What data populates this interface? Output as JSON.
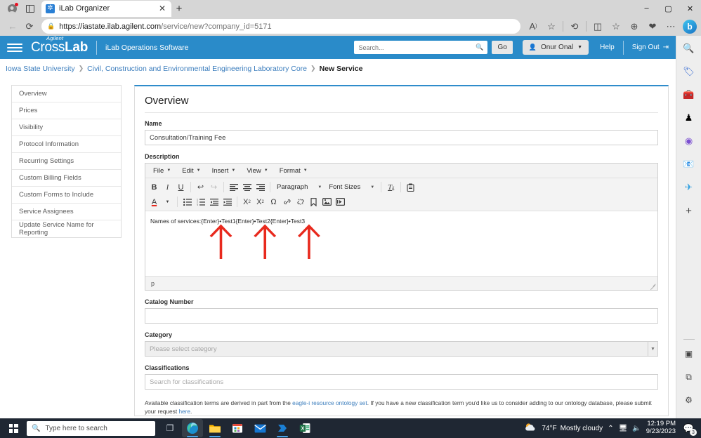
{
  "browser": {
    "tab": {
      "title": "iLab Organizer",
      "favicon": "ilab-favicon",
      "close": "✕"
    },
    "new_tab_label": "+",
    "window_controls": {
      "minimize": "–",
      "maximize": "▢",
      "close": "✕"
    },
    "nav": {
      "back": "←",
      "refresh": "⟳"
    },
    "url": {
      "lock": "🔒",
      "host": "https://iastate.ilab.agilent.com",
      "path": "/service/new?company_id=5171"
    },
    "toolbar_icons": [
      "read-aloud-icon",
      "favorite-star-icon",
      "history-icon",
      "split-screen-icon",
      "collections-icon",
      "browser-essentials-icon",
      "shopping-icon",
      "more-options-icon",
      "bing-copilot-icon"
    ]
  },
  "ilab": {
    "hamburger": "menu-icon",
    "brand": {
      "agilent": "Agilent",
      "cross": "Cross",
      "lab": "Lab"
    },
    "subtitle": "iLab Operations Software",
    "search": {
      "placeholder": "Search...",
      "value": "",
      "icon": "search-icon"
    },
    "go_label": "Go",
    "user": {
      "name": "Onur Onal",
      "icon": "user-icon",
      "caret": "▼"
    },
    "help_label": "Help",
    "signout_label": "Sign Out",
    "signout_icon": "signout-icon"
  },
  "breadcrumb": {
    "items": [
      "Iowa State University",
      "Civil, Construction and Environmental Engineering Laboratory Core"
    ],
    "current": "New Service",
    "separator": "❯"
  },
  "sidebar": {
    "items": [
      {
        "label": "Overview"
      },
      {
        "label": "Prices"
      },
      {
        "label": "Visibility"
      },
      {
        "label": "Protocol Information"
      },
      {
        "label": "Recurring Settings"
      },
      {
        "label": "Custom Billing Fields"
      },
      {
        "label": "Custom Forms to Include"
      },
      {
        "label": "Service Assignees"
      },
      {
        "label": "Update Service Name for Reporting"
      }
    ]
  },
  "form": {
    "title": "Overview",
    "name": {
      "label": "Name",
      "value": "Consultation/Training Fee"
    },
    "description": {
      "label": "Description"
    },
    "catalog": {
      "label": "Catalog Number",
      "value": "",
      "placeholder": ""
    },
    "category": {
      "label": "Category",
      "placeholder": "Please select category",
      "caret": "▼"
    },
    "classifications": {
      "label": "Classifications",
      "placeholder": "Search for classifications"
    },
    "hint": {
      "part1": "Available classification terms are derived in part from the ",
      "link1": "eagle-i resource ontology set",
      "part2": ". If you have a new classification term you'd like us to consider adding to our ontology database, please submit your request ",
      "link2": "here",
      "part3": "."
    }
  },
  "editor": {
    "menus": [
      {
        "label": "File",
        "caret": "▼"
      },
      {
        "label": "Edit",
        "caret": "▼"
      },
      {
        "label": "Insert",
        "caret": "▼"
      },
      {
        "label": "View",
        "caret": "▼"
      },
      {
        "label": "Format",
        "caret": "▼"
      }
    ],
    "row1": [
      {
        "icon": "bold-icon",
        "glyph": "B"
      },
      {
        "icon": "italic-icon",
        "glyph": "I"
      },
      {
        "icon": "underline-icon",
        "glyph": "U"
      },
      {
        "sep": true
      },
      {
        "icon": "undo-icon",
        "glyph": "↰"
      },
      {
        "icon": "redo-icon",
        "glyph": "↱",
        "dim": true
      },
      {
        "sep": true
      },
      {
        "icon": "align-left-icon",
        "glyph": "≣"
      },
      {
        "icon": "align-center-icon",
        "glyph": "≣"
      },
      {
        "icon": "align-right-icon",
        "glyph": "≣"
      }
    ],
    "paragraph_label": "Paragraph",
    "fontsize_label": "Font Sizes",
    "row1_tail": [
      {
        "icon": "clear-formatting-icon",
        "glyph": "Tx"
      },
      {
        "icon": "paste-as-text-icon",
        "glyph": "📋"
      }
    ],
    "row2": [
      {
        "icon": "text-color-icon",
        "glyph": "A"
      },
      {
        "icon": "text-color-caret-icon",
        "glyph": "▼"
      },
      {
        "sep": true
      },
      {
        "icon": "bullet-list-icon",
        "glyph": "≔"
      },
      {
        "icon": "numbered-list-icon",
        "glyph": "≕"
      },
      {
        "icon": "decrease-indent-icon",
        "glyph": "⇤"
      },
      {
        "icon": "increase-indent-icon",
        "glyph": "⇥"
      },
      {
        "sep": true
      },
      {
        "icon": "subscript-icon",
        "glyph": "X₂"
      },
      {
        "icon": "superscript-icon",
        "glyph": "X²"
      },
      {
        "icon": "special-character-icon",
        "glyph": "Ω"
      },
      {
        "icon": "insert-link-icon",
        "glyph": "🔗"
      },
      {
        "icon": "unlink-icon",
        "glyph": "⛓"
      },
      {
        "icon": "anchor-icon",
        "glyph": "🔖"
      },
      {
        "icon": "insert-image-icon",
        "glyph": "🖼"
      },
      {
        "icon": "insert-media-icon",
        "glyph": "▦"
      }
    ],
    "content": "Names of services:{Enter}•Test1{Enter}•Test2{Enter}•Test3",
    "statusbar_path": "p",
    "annotation": {
      "color": "#e8291d",
      "count": 3,
      "shape": "up-arrow"
    }
  },
  "scrollbar": {
    "up": "▲",
    "down": "▼"
  },
  "edge_sidebar": {
    "items": [
      {
        "icon": "search-sidebar-icon",
        "glyph": "🔍"
      },
      {
        "icon": "shopping-tag-icon",
        "glyph": "🏷"
      },
      {
        "icon": "tools-icon",
        "glyph": "🧰"
      },
      {
        "icon": "games-icon",
        "glyph": "♟"
      },
      {
        "icon": "microsoft-designer-icon",
        "glyph": "◓"
      },
      {
        "icon": "outlook-icon",
        "glyph": "📧"
      },
      {
        "icon": "telegram-icon",
        "glyph": "✈"
      },
      {
        "icon": "add-sidebar-app-icon",
        "glyph": "+"
      }
    ],
    "bottom": [
      {
        "icon": "split-pane-icon",
        "glyph": "▣"
      },
      {
        "icon": "open-in-new-window-icon",
        "glyph": "⧉"
      },
      {
        "icon": "sidebar-settings-icon",
        "glyph": "⚙"
      }
    ]
  },
  "taskbar": {
    "start_icon": "windows-start-icon",
    "search": {
      "placeholder": "Type here to search",
      "icon": "search-icon"
    },
    "apps": [
      {
        "icon": "task-view-icon",
        "glyph": "❐"
      },
      {
        "icon": "microsoft-edge-icon",
        "glyph": "◉",
        "active": true
      },
      {
        "icon": "file-explorer-icon",
        "glyph": "🗂"
      },
      {
        "icon": "microsoft-store-icon",
        "glyph": "🛍"
      },
      {
        "icon": "mail-icon",
        "glyph": "✉"
      },
      {
        "icon": "power-automate-icon",
        "glyph": "➤"
      },
      {
        "icon": "excel-icon",
        "glyph": "X"
      }
    ],
    "weather": {
      "icon": "partly-cloudy-icon",
      "temp": "74°F",
      "condition": "Mostly cloudy"
    },
    "tray": {
      "chevron": "⌃",
      "network": "🖥",
      "volume": "🔊"
    },
    "clock": {
      "time": "12:19 PM",
      "date": "9/23/2023"
    },
    "notifications": {
      "icon": "notifications-icon",
      "count": "3"
    }
  },
  "colors": {
    "ilab_blue": "#2a8bc9",
    "card_top_accent": "#2f8ccb",
    "link_blue": "#3b7dbd",
    "annotation_red": "#e8291d",
    "taskbar_bg": "#1f2733"
  }
}
